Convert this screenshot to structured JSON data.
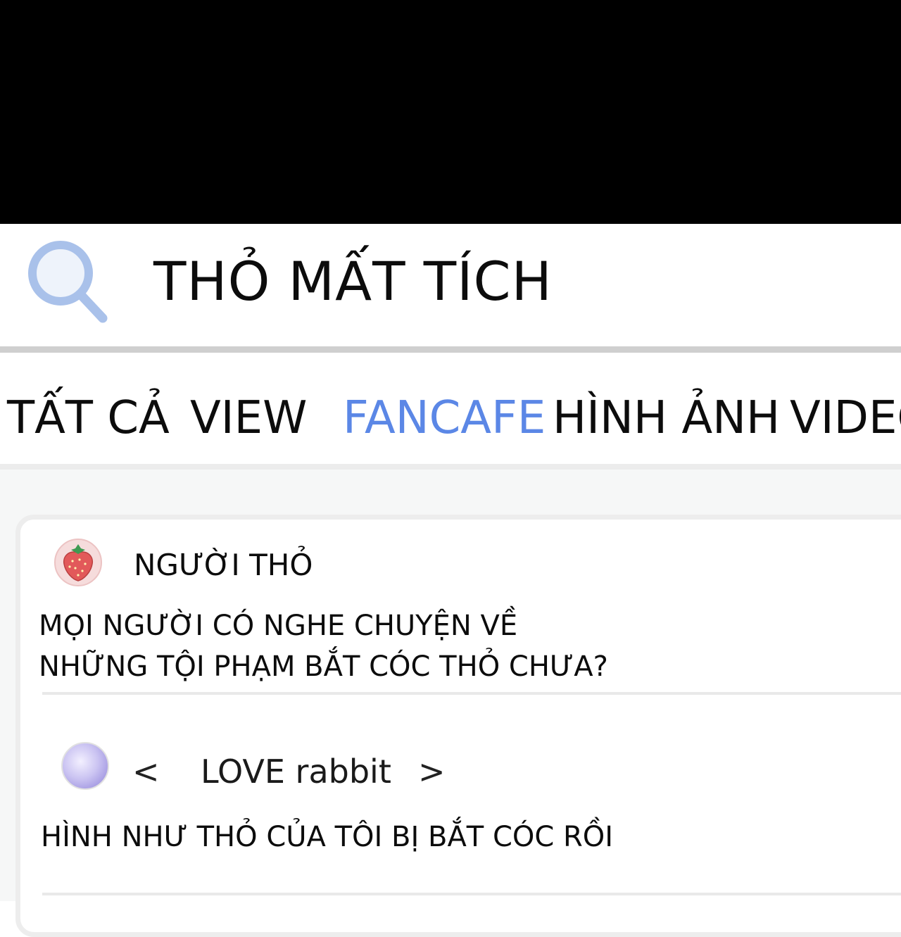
{
  "search": {
    "query": "THỎ MẤT TÍCH",
    "icon": "search-icon",
    "icon_color": "#a9c1ea"
  },
  "tabs": [
    {
      "label": "TẤT CẢ",
      "active": false
    },
    {
      "label": "VIEW",
      "active": false
    },
    {
      "label": "FANCAFE",
      "active": true
    },
    {
      "label": "HÌNH ẢNH",
      "active": false
    },
    {
      "label": "VIDEO",
      "active": false
    }
  ],
  "colors": {
    "active_tab": "#5b87e6",
    "top_band": "#000000"
  },
  "results": [
    {
      "author": "NGƯỜI THỎ",
      "avatar": "strawberry-avatar",
      "lines": [
        "MỌI NGƯỜI CÓ NGHE CHUYỆN VỀ",
        "NHỮNG TỘI PHẠM BẮT CÓC THỎ CHƯA?"
      ]
    },
    {
      "author": "LOVE rabbit",
      "avatar": "flower-avatar",
      "prev": "<",
      "next": ">",
      "lines": [
        "HÌNH NHƯ THỎ CỦA TÔI BỊ BẮT CÓC RỒI"
      ]
    }
  ]
}
